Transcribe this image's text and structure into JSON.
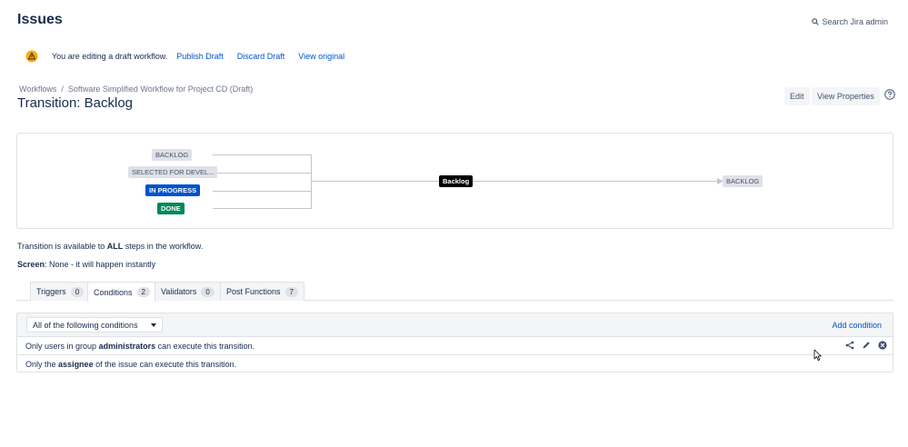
{
  "header": {
    "title": "Issues",
    "search_label": "Search Jira admin"
  },
  "banner": {
    "message": "You are editing a draft workflow.",
    "publish": "Publish Draft",
    "discard": "Discard Draft",
    "view_original": "View original"
  },
  "breadcrumb": {
    "root": "Workflows",
    "separator": "/",
    "current": "Software Simplified Workflow for Project CD (Draft)"
  },
  "transition_title": "Transition: Backlog",
  "actions": {
    "edit": "Edit",
    "view_properties": "View Properties"
  },
  "diagram": {
    "sources": [
      "BACKLOG",
      "SELECTED FOR DEVEL...",
      "IN PROGRESS",
      "DONE"
    ],
    "transition": "Backlog",
    "target": "BACKLOG"
  },
  "availability": {
    "prefix": "Transition is available to ",
    "emphasis": "ALL",
    "suffix": " steps in the workflow."
  },
  "screen": {
    "label": "Screen",
    "value": ": None - it will happen instantly"
  },
  "tabs": [
    {
      "label": "Triggers",
      "count": "0"
    },
    {
      "label": "Conditions",
      "count": "2"
    },
    {
      "label": "Validators",
      "count": "0"
    },
    {
      "label": "Post Functions",
      "count": "7"
    }
  ],
  "conditions": {
    "select_value": "All of the following conditions",
    "add_label": "Add condition",
    "rows": [
      {
        "pre": "Only users in group ",
        "bold": "administrators",
        "post": " can execute this transition."
      },
      {
        "pre": "Only the ",
        "bold": "assignee",
        "post": " of the issue can execute this transition."
      }
    ]
  },
  "colors": {
    "link": "#0052cc",
    "in_progress": "#0052cc",
    "done": "#00875a",
    "warning": "#ffab00"
  }
}
